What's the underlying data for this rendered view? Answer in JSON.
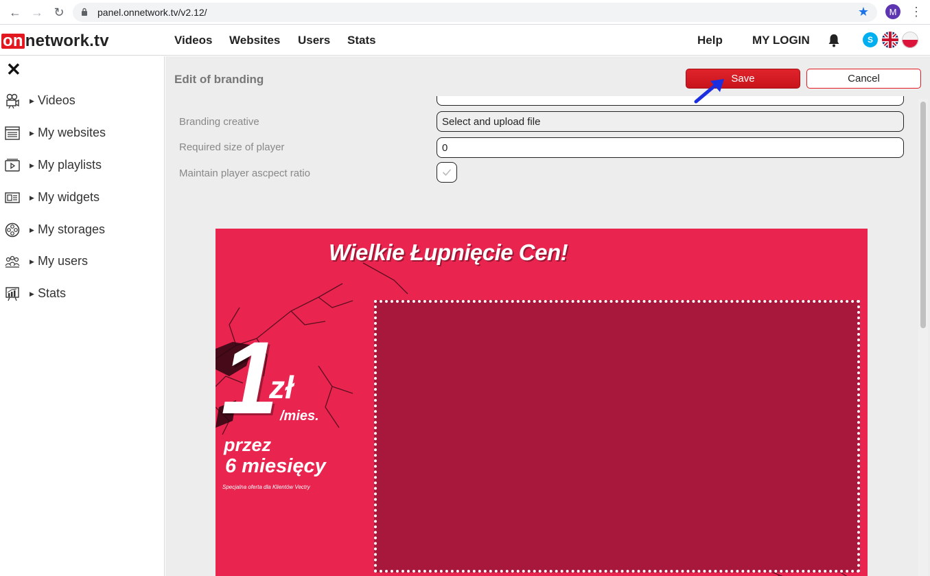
{
  "browser": {
    "url": "panel.onnetwork.tv/v2.12/",
    "profile_initial": "M"
  },
  "header": {
    "logo_on": "on",
    "logo_rest": "network.tv",
    "nav": [
      "Videos",
      "Websites",
      "Users",
      "Stats"
    ],
    "help": "Help",
    "login": "MY LOGIN",
    "skype_glyph": "S"
  },
  "sidebar": {
    "close_glyph": "✕",
    "items": [
      {
        "label": "Videos",
        "icon": "camera-icon"
      },
      {
        "label": "My websites",
        "icon": "websites-icon"
      },
      {
        "label": "My playlists",
        "icon": "playlist-icon"
      },
      {
        "label": "My widgets",
        "icon": "widget-icon"
      },
      {
        "label": "My storages",
        "icon": "storage-icon"
      },
      {
        "label": "My users",
        "icon": "users-icon"
      },
      {
        "label": "Stats",
        "icon": "stats-icon"
      }
    ]
  },
  "main": {
    "title": "Edit of branding",
    "save_label": "Save",
    "cancel_label": "Cancel",
    "fields": {
      "creative_label": "Branding creative",
      "creative_value": "Select and upload file",
      "size_label": "Required size of player",
      "size_value": "0",
      "ratio_label": "Maintain player ascpect ratio",
      "ratio_checked": true
    }
  },
  "creative": {
    "title": "Wielkie Łupnięcie Cen!",
    "big_number": "1",
    "currency": "zł",
    "per": "/mies.",
    "line1": "przez",
    "line2": "6 miesięcy",
    "footnote": "Specjalna oferta dla Klientów Vectry"
  },
  "colors": {
    "brand_red": "#e3171f",
    "creative_pink": "#e8244f",
    "player_area": "#a8173c"
  }
}
